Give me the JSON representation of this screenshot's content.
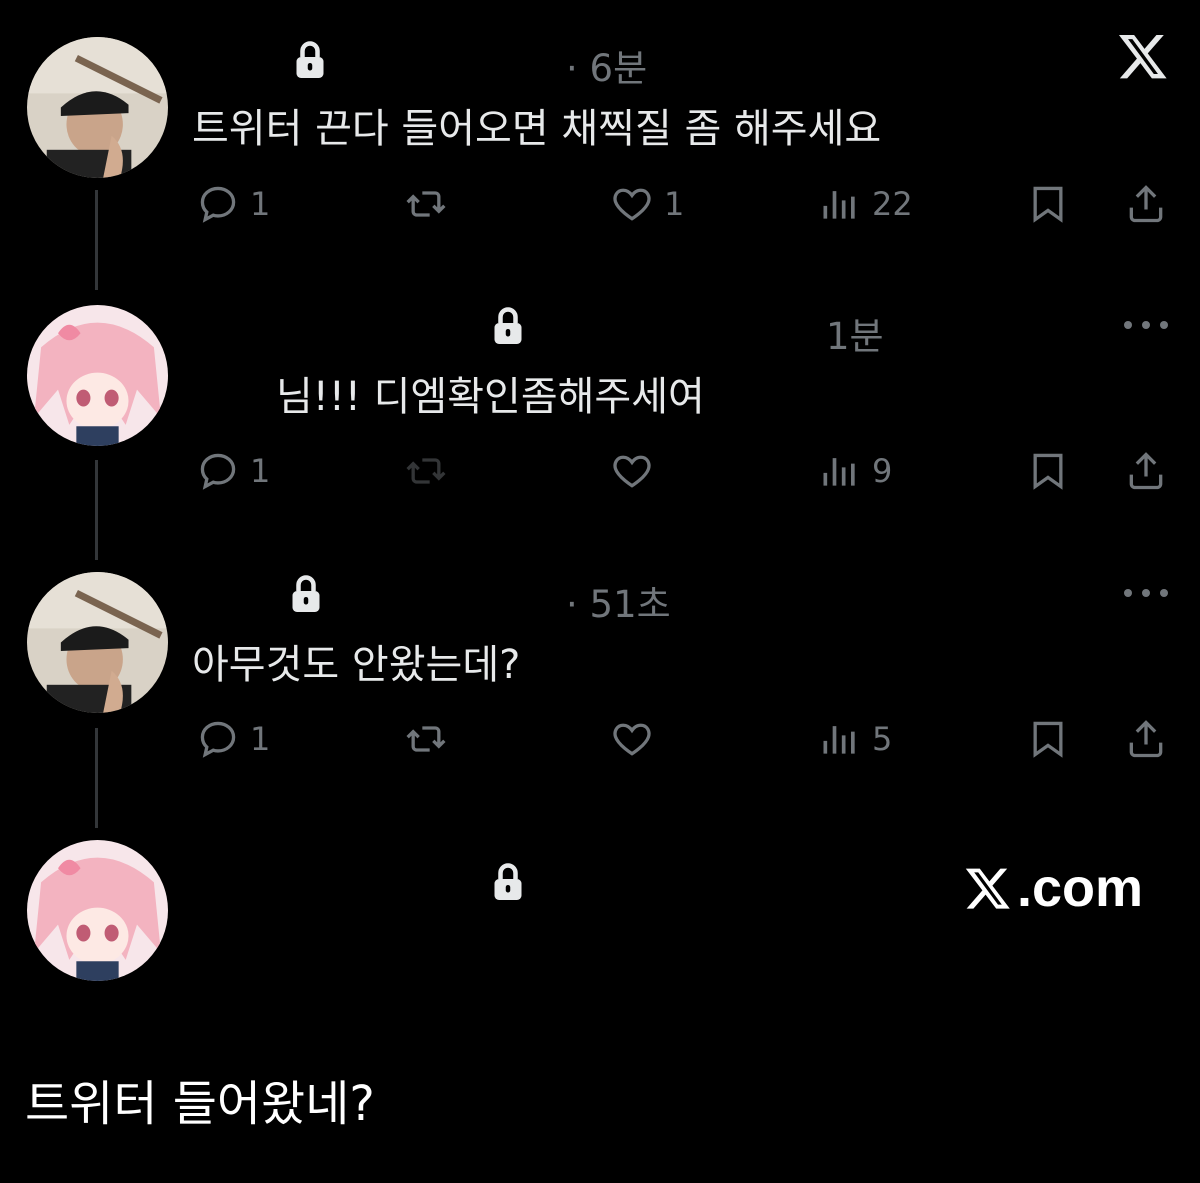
{
  "header": {
    "logo_icon": "x-logo-icon"
  },
  "tweets": [
    {
      "avatar": "photo-avatar",
      "time": "· 6분",
      "text": "트위터 끈다 들어오면 채찍질 좀 해주세요",
      "replies": "1",
      "retweets": "",
      "likes": "1",
      "views": "22"
    },
    {
      "avatar": "anime-avatar",
      "time": "1분",
      "text": "님!!! 디엠확인좀해주세여",
      "replies": "1",
      "retweets": "",
      "likes": "",
      "views": "9"
    },
    {
      "avatar": "photo-avatar",
      "time": "· 51초",
      "text": "아무것도 안왔는데?",
      "replies": "1",
      "retweets": "",
      "likes": "",
      "views": "5"
    },
    {
      "avatar": "anime-avatar"
    }
  ],
  "watermark": {
    "label": ".com"
  },
  "caption": "트위터 들어왔네?",
  "colors": {
    "background": "#000000",
    "text": "#e7e9ea",
    "muted": "#71767b",
    "thread_line": "#333639"
  }
}
